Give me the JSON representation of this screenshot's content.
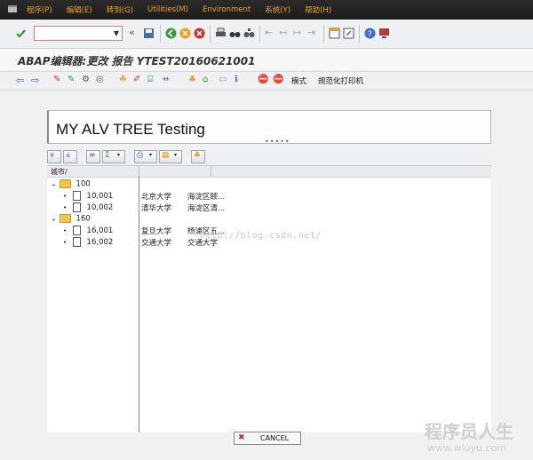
{
  "menu": {
    "items": [
      "程序(P)",
      "编辑(E)",
      "转到(G)",
      "Utilities(M)",
      "Environment",
      "系统(Y)",
      "帮助(H)"
    ]
  },
  "toolbar": {
    "command_value": "",
    "icons": [
      "check-icon",
      "back-nav-icon",
      "save-icon",
      "back-icon",
      "exit-icon",
      "cancel-icon",
      "print-icon",
      "find-icon",
      "find-next-icon",
      "first-page-icon",
      "prev-page-icon",
      "next-page-icon",
      "last-page-icon",
      "new-session-icon",
      "shortcut-icon",
      "help-icon",
      "customize-icon"
    ]
  },
  "screen": {
    "title": "ABAP编辑器:更改 报告 YTEST20160621001"
  },
  "app_toolbar": {
    "mode_label": "模式",
    "pretty_print_label": "规范化打印机"
  },
  "alv": {
    "title": "MY ALV TREE Testing",
    "column_header": "城市/",
    "nodes": [
      {
        "label": "100",
        "children": [
          {
            "id": "10,001",
            "name": "北京大学",
            "addr": "海淀区颐..."
          },
          {
            "id": "10,002",
            "name": "清华大学",
            "addr": "海淀区清..."
          }
        ]
      },
      {
        "label": "160",
        "children": [
          {
            "id": "16,001",
            "name": "复旦大学",
            "addr": "杨浦区五..."
          },
          {
            "id": "16,002",
            "name": "交通大学",
            "addr": "交通大学"
          }
        ]
      }
    ]
  },
  "footer": {
    "cancel_label": "CANCEL"
  },
  "watermarks": {
    "blog": "http://blog.csdn.net/",
    "logo": "程序员人生",
    "site": "www.wluyu.com"
  },
  "colors": {
    "menu_text": "#f0a21e",
    "menu_bg": "#222222",
    "folder": "#f3c54d",
    "cancel_x": "#d02020"
  }
}
